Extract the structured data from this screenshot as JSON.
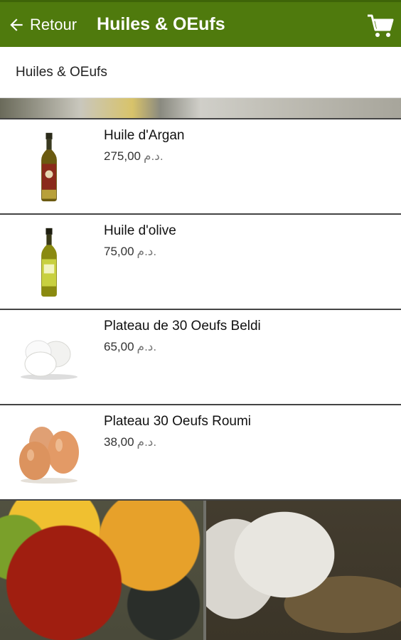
{
  "appbar": {
    "back_label": "Retour",
    "title": "Huiles & OEufs",
    "color": "#4f7a0d"
  },
  "breadcrumb": {
    "text": "Huiles & OEufs"
  },
  "products": [
    {
      "name": "Huile d'Argan",
      "price": "275,00",
      "currency": "د.م.",
      "image": "argan-oil-bottle"
    },
    {
      "name": "Huile d'olive",
      "price": "75,00",
      "currency": "د.م.",
      "image": "olive-oil-bottle"
    },
    {
      "name": "Plateau de 30 Oeufs Beldi",
      "price": "65,00",
      "currency": "د.م.",
      "image": "white-eggs"
    },
    {
      "name": "Plateau 30 Oeufs Roumi",
      "price": "38,00",
      "currency": "د.م.",
      "image": "brown-eggs"
    }
  ]
}
